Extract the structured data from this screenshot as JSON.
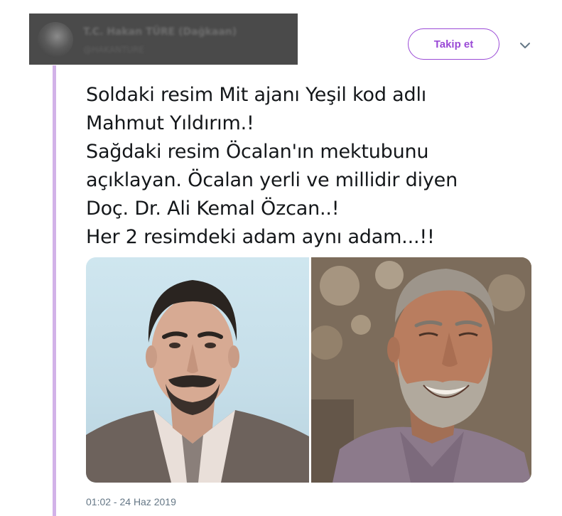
{
  "author": {
    "name": "T.C. Hakan TÜRE (Dağkaan)",
    "handle": "@HAKANTURE"
  },
  "actions": {
    "follow_label": "Takip et",
    "more_icon": "chevron-down-icon"
  },
  "tweet": {
    "lines": [
      "Soldaki resim Mit ajanı Yeşil kod adlı",
      "Mahmut Yıldırım.!",
      "Sağdaki resim Öcalan'ın mektubunu",
      "açıklayan. Öcalan yerli ve millidir diyen",
      "Doç. Dr. Ali Kemal Özcan..!",
      "Her 2 resimdeki adam aynı adam...!!"
    ],
    "timestamp": "01:02 - 24 Haz 2019"
  },
  "colors": {
    "accent": "#9a4ad6",
    "thread_line": "#d2b2e8",
    "text": "#14171a",
    "muted": "#657786"
  }
}
